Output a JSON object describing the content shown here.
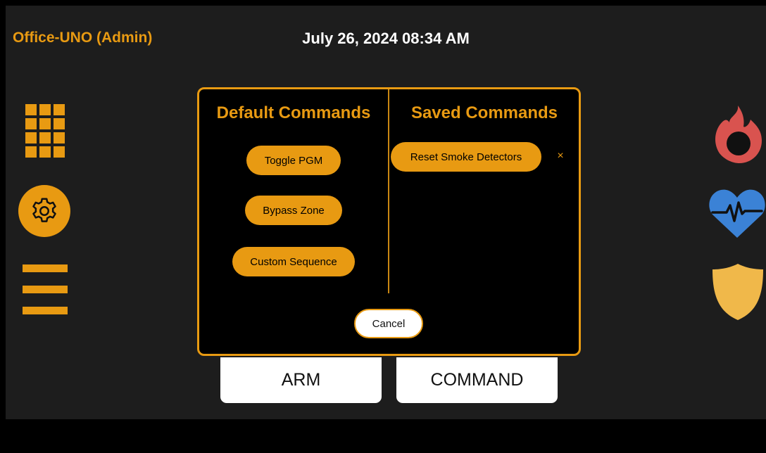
{
  "header": {
    "account": "Office-UNO (Admin)",
    "datetime": "July 26, 2024 08:34 AM"
  },
  "sidebar_left": {
    "icons": [
      "keypad-grid-icon",
      "gear-icon",
      "menu-icon"
    ]
  },
  "sidebar_right": {
    "icons": [
      "fire-icon",
      "health-heart-icon",
      "shield-icon"
    ]
  },
  "tiles": {
    "arm": "ARM",
    "command": "COMMAND"
  },
  "modal": {
    "default_title": "Default Commands",
    "saved_title": "Saved Commands",
    "default_commands": [
      "Toggle PGM",
      "Bypass Zone",
      "Custom Sequence"
    ],
    "saved_commands": [
      "Reset Smoke Detectors"
    ],
    "remove_symbol": "×",
    "cancel": "Cancel"
  },
  "colors": {
    "accent": "#e89a12",
    "background": "#1d1d1d",
    "fire": "#d9534f",
    "health": "#3b82d6",
    "shield": "#f0b84a"
  }
}
